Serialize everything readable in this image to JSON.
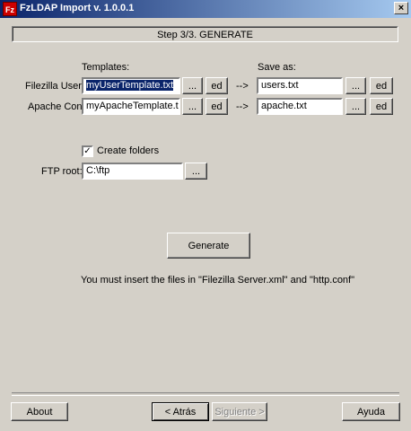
{
  "window": {
    "icon_text": "Fz",
    "title": "FzLDAP Import  v. 1.0.0.1",
    "close_glyph": "×"
  },
  "step_label": "Step 3/3. GENERATE",
  "headers": {
    "templates": "Templates:",
    "save_as": "Save as:"
  },
  "rows": [
    {
      "label": "Filezilla Users:",
      "template_value": "myUserTemplate.txt",
      "browse_label": "...",
      "edit_label": "ed",
      "arrow": "-->",
      "save_value": "users.txt",
      "save_browse_label": "...",
      "save_edit_label": "ed"
    },
    {
      "label": "Apache Conf:",
      "template_value": "myApacheTemplate.txt",
      "browse_label": "...",
      "edit_label": "ed",
      "arrow": "-->",
      "save_value": "apache.txt",
      "save_browse_label": "...",
      "save_edit_label": "ed"
    }
  ],
  "create_folders": {
    "checked": true,
    "mark": "✓",
    "label": "Create folders"
  },
  "ftp_root": {
    "label": "FTP root:",
    "value": "C:\\ftp",
    "browse_label": "..."
  },
  "generate_label": "Generate",
  "message": "You must insert the files in \"Filezilla Server.xml\" and \"http.conf\"",
  "footer": {
    "about": "About",
    "back": "< Atrás",
    "next": "Siguiente >",
    "help": "Ayuda"
  }
}
